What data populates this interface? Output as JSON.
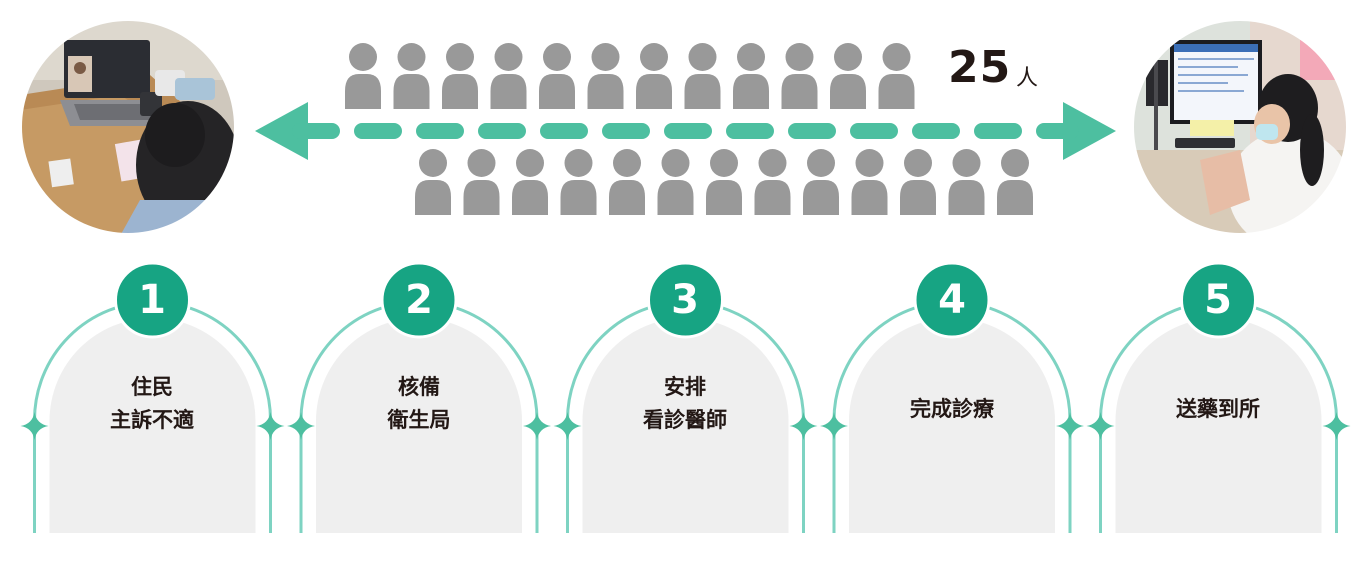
{
  "colors": {
    "accent": "#4dbfa0",
    "badge": "#17a483",
    "arc_line": "#7ed3c2",
    "card": "#efefef",
    "person": "#999999",
    "text": "#231815"
  },
  "photos": {
    "left_icon": "resident-video-call-photo",
    "right_icon": "doctor-at-computer-photo"
  },
  "queue": {
    "count": "25",
    "unit": "人",
    "top_row_people": 12,
    "bottom_row_people": 13,
    "person_icon": "person-icon",
    "arrow_icon": "double-headed-dashed-arrow-icon"
  },
  "steps": [
    {
      "number": "1",
      "lines": [
        "住民",
        "主訴不適"
      ]
    },
    {
      "number": "2",
      "lines": [
        "核備",
        "衛生局"
      ]
    },
    {
      "number": "3",
      "lines": [
        "安排",
        "看診醫師"
      ]
    },
    {
      "number": "4",
      "lines": [
        "完成診療"
      ]
    },
    {
      "number": "5",
      "lines": [
        "送藥到所"
      ]
    }
  ]
}
